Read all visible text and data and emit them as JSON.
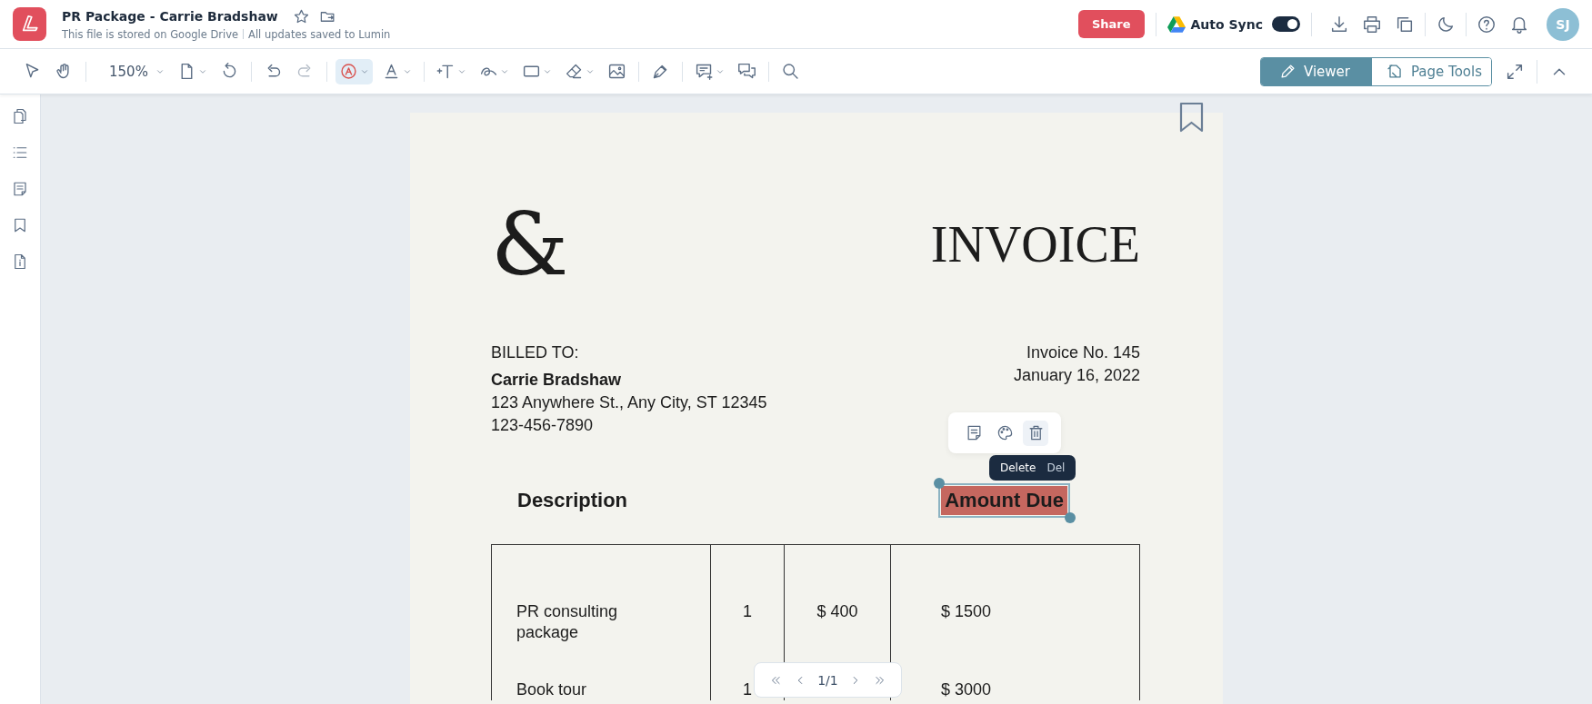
{
  "header": {
    "title": "PR Package - Carrie Bradshaw",
    "storage_note": "This file is stored on Google Drive",
    "save_status": "All updates saved to Lumin",
    "share_button": "Share",
    "auto_sync": {
      "label": "Auto Sync",
      "on": true
    },
    "avatar": "SJ"
  },
  "toolbar": {
    "tools": [
      {
        "kind": "pointer",
        "selected": false,
        "disabled": false
      },
      {
        "kind": "hand",
        "selected": false,
        "disabled": false
      },
      {
        "kind": "zoom",
        "label": "150%",
        "selected": false,
        "disabled": false
      },
      {
        "kind": "page",
        "selected": false,
        "disabled": false
      },
      {
        "kind": "rotate",
        "selected": false,
        "disabled": false
      },
      {
        "kind": "undo",
        "selected": false,
        "disabled": false
      },
      {
        "kind": "redo",
        "selected": false,
        "disabled": true
      },
      {
        "kind": "highlight",
        "selected": true,
        "disabled": false
      },
      {
        "kind": "text-color",
        "selected": false,
        "disabled": false
      },
      {
        "kind": "text",
        "selected": false,
        "disabled": false
      },
      {
        "kind": "freehand",
        "selected": false,
        "disabled": false
      },
      {
        "kind": "shape",
        "selected": false,
        "disabled": false
      },
      {
        "kind": "eraser",
        "selected": false,
        "disabled": false
      },
      {
        "kind": "image",
        "selected": false,
        "disabled": false
      },
      {
        "kind": "signature",
        "selected": false,
        "disabled": false
      },
      {
        "kind": "comment",
        "selected": false,
        "disabled": false
      },
      {
        "kind": "comments",
        "selected": false,
        "disabled": false
      },
      {
        "kind": "search",
        "selected": false,
        "disabled": false
      }
    ],
    "modes": [
      {
        "label": "Viewer",
        "selected": true
      },
      {
        "label": "Page Tools",
        "selected": false
      }
    ]
  },
  "document": {
    "logo_mark": "&",
    "title": "INVOICE",
    "billed_to_label": "BILLED TO:",
    "client_name": "Carrie Bradshaw",
    "address": "123 Anywhere St., Any City, ST 12345",
    "phone": "123-456-7890",
    "invoice_number": "Invoice No. 145",
    "date": "January 16, 2022",
    "description_heading": "Description",
    "amount_due_heading": "Amount Due",
    "rows": [
      {
        "description": "PR consulting package",
        "quantity": "1",
        "price": "$ 400",
        "total": "$ 1500"
      },
      {
        "description": "Book tour",
        "quantity": "1",
        "total": "$ 3000"
      }
    ]
  },
  "annotation_tooltip": {
    "label": "Delete",
    "shortcut": "Del"
  },
  "pagination": {
    "page": "1/1"
  }
}
